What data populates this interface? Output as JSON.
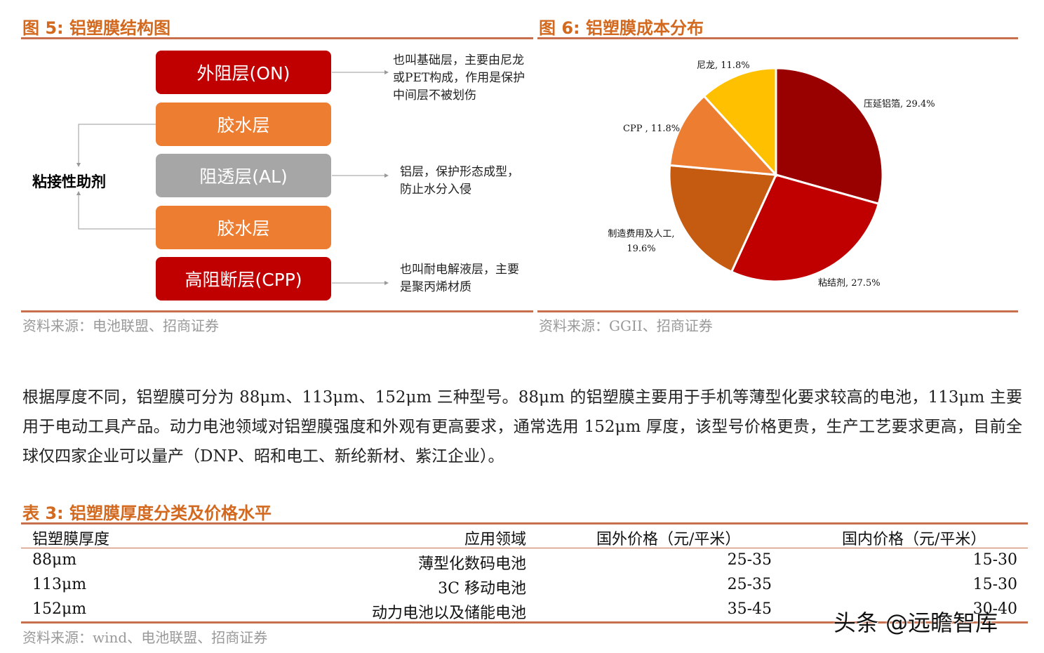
{
  "fig5": {
    "title": "图 5:  铝塑膜结构图",
    "source": "资料来源：电池联盟、招商证券",
    "layers": [
      {
        "label": "外阻层(ON)",
        "color": "#C00000"
      },
      {
        "label": "胶水层",
        "color": "#ED7D31"
      },
      {
        "label": "阻透层(AL)",
        "color": "#A6A6A6"
      },
      {
        "label": "胶水层",
        "color": "#ED7D31"
      },
      {
        "label": "高阻断层(CPP)",
        "color": "#C00000"
      }
    ],
    "side_label": "粘接性助剂",
    "notes": [
      "也叫基础层，主要由尼龙或PET构成，作用是保护中间层不被划伤",
      "铝层，保护形态成型，防止水分入侵",
      "也叫耐电解液层，主要是聚丙烯材质"
    ]
  },
  "fig6": {
    "title": "图 6:  铝塑膜成本分布",
    "source": "资料来源：GGII、招商证券"
  },
  "chart_data": {
    "type": "pie",
    "title": "",
    "slices": [
      {
        "name": "压延铝箔",
        "value": 29.4,
        "label": "压延铝箔, 29.4%",
        "color": "#990000"
      },
      {
        "name": "粘结剂",
        "value": 27.5,
        "label": "粘结剂, 27.5%",
        "color": "#C00000"
      },
      {
        "name": "制造费用及人工",
        "value": 19.6,
        "label": "制造费用及人工, 19.6%",
        "color": "#C55A11"
      },
      {
        "name": "CPP",
        "value": 11.8,
        "label": "CPP , 11.8%",
        "color": "#ED7D31"
      },
      {
        "name": "尼龙",
        "value": 11.8,
        "label": "尼龙, 11.8%",
        "color": "#FFC000"
      }
    ]
  },
  "paragraph": "根据厚度不同，铝塑膜可分为 88μm、113μm、152μm 三种型号。88μm 的铝塑膜主要用于手机等薄型化要求较高的电池，113μm 主要用于电动工具产品。动力电池领域对铝塑膜强度和外观有更高要求，通常选用 152μm 厚度，该型号价格更贵，生产工艺要求更高，目前全球仅四家企业可以量产（DNP、昭和电工、新纶新材、紫江企业）。",
  "table": {
    "title": "表 3:  铝塑膜厚度分类及价格水平",
    "headers": [
      "铝塑膜厚度",
      "应用领域",
      "国外价格（元/平米）",
      "国内价格（元/平米）"
    ],
    "rows": [
      [
        "88μm",
        "薄型化数码电池",
        "25-35",
        "15-30"
      ],
      [
        "113μm",
        "3C 移动电池",
        "25-35",
        "15-30"
      ],
      [
        "152μm",
        "动力电池以及储能电池",
        "35-45",
        "30-40"
      ]
    ],
    "source": "资料来源：wind、电池联盟、招商证券"
  },
  "watermark": "头条 @远瞻智库"
}
